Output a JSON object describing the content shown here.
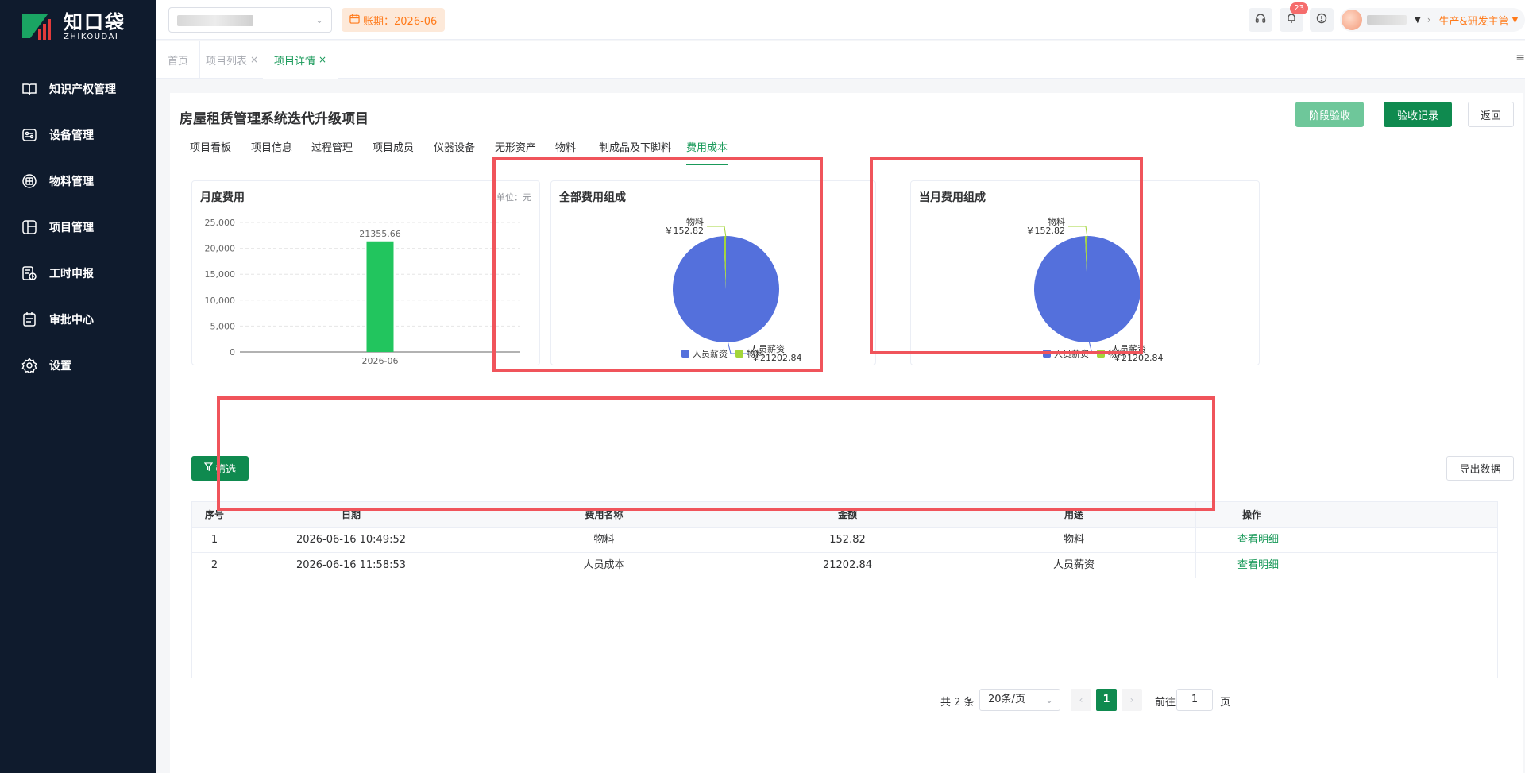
{
  "brand": {
    "name_cn": "知口袋",
    "name_en": "ZHIKOUDAI"
  },
  "sidebar": {
    "items": [
      {
        "label": "知识产权管理",
        "icon": "book-icon"
      },
      {
        "label": "设备管理",
        "icon": "device-icon"
      },
      {
        "label": "物料管理",
        "icon": "material-icon"
      },
      {
        "label": "项目管理",
        "icon": "project-icon"
      },
      {
        "label": "工时申报",
        "icon": "timesheet-icon"
      },
      {
        "label": "审批中心",
        "icon": "approval-icon"
      },
      {
        "label": "设置",
        "icon": "gear-icon"
      }
    ]
  },
  "header": {
    "period": "账期：2026-06",
    "notification_count": "23",
    "role": "生产&研发主管"
  },
  "tabs": [
    {
      "label": "首页"
    },
    {
      "label": "项目列表"
    },
    {
      "label": "项目详情"
    }
  ],
  "page": {
    "title": "房屋租赁管理系统迭代升级项目",
    "buttons": {
      "stage_accept": "阶段验收",
      "accept_record": "验收记录",
      "back": "返回"
    },
    "subtabs": [
      "项目看板",
      "项目信息",
      "过程管理",
      "项目成员",
      "仪器设备",
      "无形资产",
      "物料",
      "制成品及下脚料",
      "费用成本"
    ],
    "active_subtab": "费用成本",
    "filter_label": "筛选",
    "export_label": "导出数据"
  },
  "panels": {
    "monthly": {
      "title": "月度费用",
      "unit": "单位：元"
    },
    "all": {
      "title": "全部费用组成"
    },
    "current": {
      "title": "当月费用组成"
    }
  },
  "chart_data": [
    {
      "type": "bar",
      "title": "月度费用",
      "categories": [
        "2026-06"
      ],
      "values": [
        21355.66
      ],
      "data_labels": [
        "21355.66"
      ],
      "ylim": [
        0,
        25000
      ],
      "yticks": [
        0,
        5000,
        10000,
        15000,
        20000,
        25000
      ],
      "ytick_labels": [
        "0",
        "5,000",
        "10,000",
        "15,000",
        "20,000",
        "25,000"
      ],
      "color": "#22c55e",
      "grid": true
    },
    {
      "type": "pie",
      "title": "全部费用组成",
      "slices": [
        {
          "name": "人员薪资",
          "value": 21202.84,
          "label": "￥21202.84",
          "color": "#5470dc"
        },
        {
          "name": "物料",
          "value": 152.82,
          "label": "￥152.82",
          "color": "#a3d53b"
        }
      ],
      "legend": "bottom"
    },
    {
      "type": "pie",
      "title": "当月费用组成",
      "slices": [
        {
          "name": "人员薪资",
          "value": 21202.84,
          "label": "￥21202.84",
          "color": "#5470dc"
        },
        {
          "name": "物料",
          "value": 152.82,
          "label": "￥152.82",
          "color": "#a3d53b"
        }
      ],
      "legend": "bottom"
    }
  ],
  "table": {
    "headers": [
      "序号",
      "日期",
      "费用名称",
      "金额",
      "用途",
      "操作"
    ],
    "rows": [
      {
        "no": "1",
        "date": "2026-06-16 10:49:52",
        "name": "物料",
        "amount": "152.82",
        "usage": "物料",
        "action": "查看明细"
      },
      {
        "no": "2",
        "date": "2026-06-16 11:58:53",
        "name": "人员成本",
        "amount": "21202.84",
        "usage": "人员薪资",
        "action": "查看明细"
      }
    ]
  },
  "pagination": {
    "total": "共 2 条",
    "page_size": "20条/页",
    "current": "1",
    "goto_prefix": "前往",
    "goto_value": "1",
    "goto_suffix": "页"
  },
  "colors": {
    "primary": "#0f8a4f",
    "accent": "#ff7a1a",
    "highlight": "#f0545b",
    "sidebar_bg": "#0f1b2d"
  }
}
